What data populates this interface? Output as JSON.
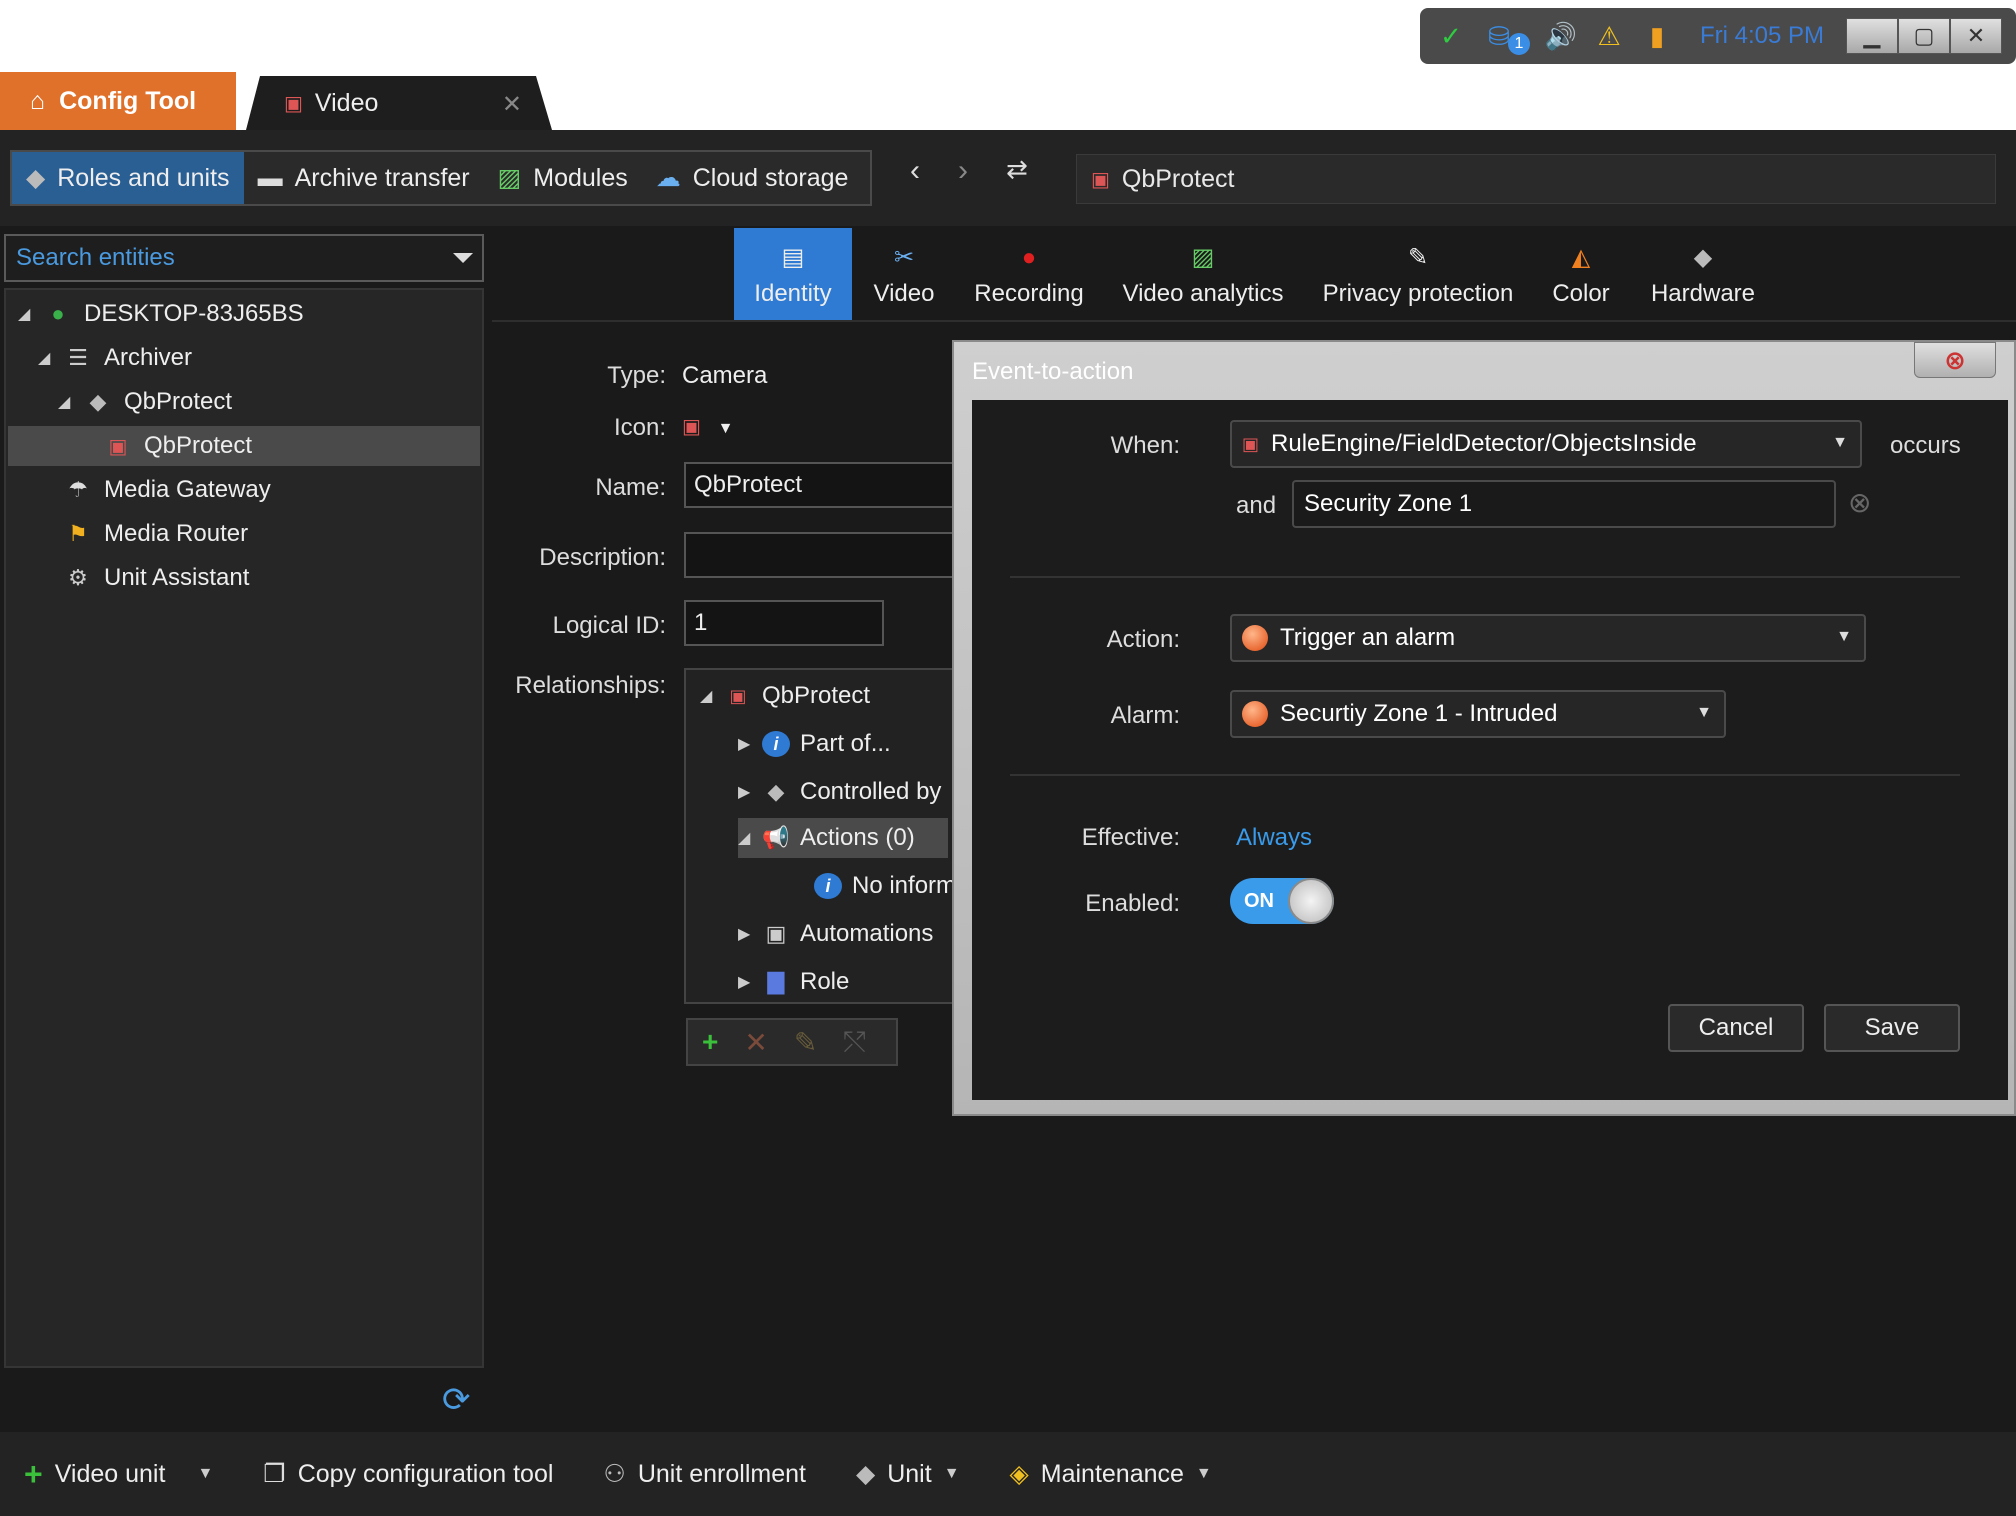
{
  "tray": {
    "time": "Fri 4:05 PM",
    "badge": "1"
  },
  "tabs": {
    "config": "Config Tool",
    "video": "Video"
  },
  "toolbar": {
    "nav": [
      "Roles and units",
      "Archive transfer",
      "Modules",
      "Cloud storage"
    ],
    "breadcrumb": "QbProtect"
  },
  "search": {
    "placeholder": "Search entities"
  },
  "tree": {
    "items": [
      "DESKTOP-83J65BS",
      "Archiver",
      "QbProtect",
      "QbProtect",
      "Media Gateway",
      "Media Router",
      "Unit Assistant"
    ]
  },
  "page_tabs": [
    "Identity",
    "Video",
    "Recording",
    "Video analytics",
    "Privacy protection",
    "Color",
    "Hardware"
  ],
  "identity": {
    "type_label": "Type:",
    "type_value": "Camera",
    "icon_label": "Icon:",
    "name_label": "Name:",
    "name_value": "QbProtect",
    "description_label": "Description:",
    "description_value": "",
    "logical_id_label": "Logical ID:",
    "logical_id_value": "1",
    "relationships_label": "Relationships:",
    "relationships": [
      "QbProtect",
      "Part of...",
      "Controlled by",
      "Actions (0)",
      "No information",
      "Automations",
      "Role"
    ]
  },
  "bottombar": [
    "Video unit",
    "Copy configuration tool",
    "Unit enrollment",
    "Unit",
    "Maintenance"
  ],
  "dialog": {
    "title": "Event-to-action",
    "when_label": "When:",
    "when_value": "RuleEngine/FieldDetector/ObjectsInside",
    "occurs": "occurs",
    "and_label": "and",
    "and_value": "Security Zone 1",
    "action_label": "Action:",
    "action_value": "Trigger an alarm",
    "alarm_label": "Alarm:",
    "alarm_value": "Securtiy Zone 1 - Intruded",
    "effective_label": "Effective:",
    "effective_value": "Always",
    "enabled_label": "Enabled:",
    "enabled_value": "ON",
    "cancel": "Cancel",
    "save": "Save"
  }
}
